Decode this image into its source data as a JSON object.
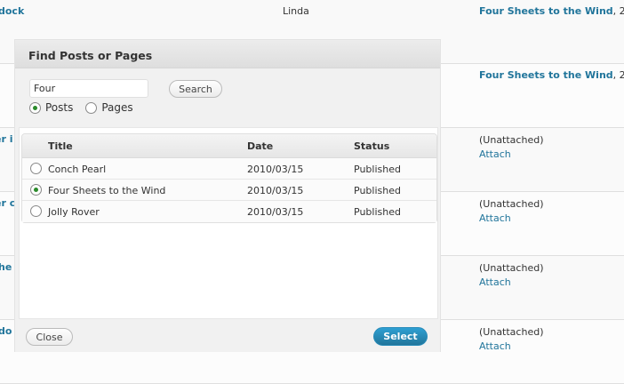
{
  "background": {
    "rows": [
      {
        "left_link": "dock",
        "author": "Linda",
        "parent_link": "Four Sheets to the Wind",
        "parent_rest": ", 2"
      },
      {
        "left_link": "",
        "author": "",
        "parent_link": "Four Sheets to the Wind",
        "parent_rest": ", 2"
      },
      {
        "left_link": "er i",
        "unattached": "(Unattached)",
        "attach": "Attach"
      },
      {
        "left_link": "er c",
        "unattached": "(Unattached)",
        "attach": "Attach"
      },
      {
        "left_link": "he",
        "unattached": "(Unattached)",
        "attach": "Attach"
      },
      {
        "left_link": "do",
        "unattached": "(Unattached)",
        "attach": "Attach"
      }
    ]
  },
  "dialog": {
    "title": "Find Posts or Pages",
    "search": {
      "value": "Four",
      "button": "Search"
    },
    "type_options": [
      {
        "label": "Posts",
        "checked": true
      },
      {
        "label": "Pages",
        "checked": false
      }
    ],
    "table": {
      "headers": {
        "title": "Title",
        "date": "Date",
        "status": "Status"
      },
      "rows": [
        {
          "title": "Conch Pearl",
          "date": "2010/03/15",
          "status": "Published",
          "selected": false
        },
        {
          "title": "Four Sheets to the Wind",
          "date": "2010/03/15",
          "status": "Published",
          "selected": true
        },
        {
          "title": "Jolly Rover",
          "date": "2010/03/15",
          "status": "Published",
          "selected": false
        }
      ]
    },
    "close_label": "Close",
    "select_label": "Select"
  },
  "colors": {
    "link": "#21759b",
    "primary_button": "#21759b",
    "radio_selected": "#2a8a2a"
  }
}
